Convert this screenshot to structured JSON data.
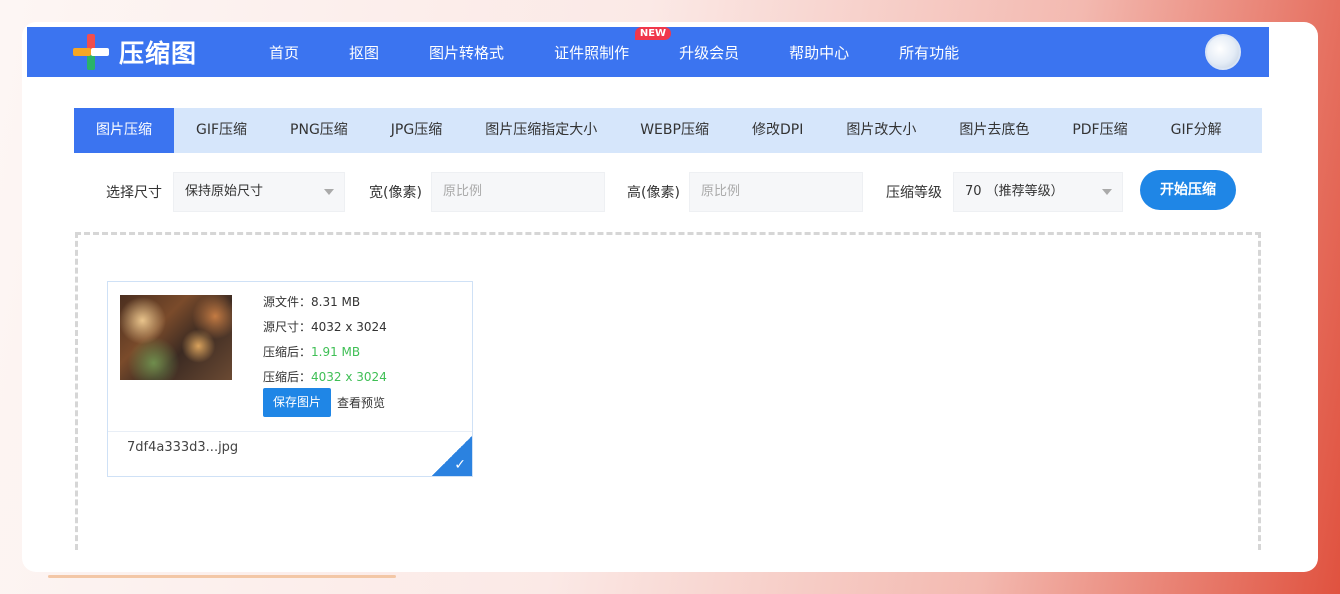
{
  "header": {
    "brand": "压缩图",
    "nav": [
      {
        "label": "首页"
      },
      {
        "label": "抠图"
      },
      {
        "label": "图片转格式"
      },
      {
        "label": "证件照制作",
        "badge": "NEW"
      },
      {
        "label": "升级会员"
      },
      {
        "label": "帮助中心"
      },
      {
        "label": "所有功能"
      }
    ]
  },
  "tabs": [
    "图片压缩",
    "GIF压缩",
    "PNG压缩",
    "JPG压缩",
    "图片压缩指定大小",
    "WEBP压缩",
    "修改DPI",
    "图片改大小",
    "图片去底色",
    "PDF压缩",
    "GIF分解"
  ],
  "options": {
    "size_label": "选择尺寸",
    "size_value": "保持原始尺寸",
    "width_label": "宽(像素)",
    "width_placeholder": "原比例",
    "height_label": "高(像素)",
    "height_placeholder": "原比例",
    "level_label": "压缩等级",
    "level_value": "70 （推荐等级）",
    "start_button": "开始压缩"
  },
  "file": {
    "source_size": "源文件：8.31 MB",
    "source_dims": "源尺寸：4032 x 3024",
    "compressed_size_label": "压缩后：",
    "compressed_size": "1.91 MB",
    "compressed_dims_label": "压缩后：",
    "compressed_dims": "4032 x 3024",
    "save_button": "保存图片",
    "preview_link": "查看预览",
    "filename": "7df4a333d3...jpg"
  },
  "colors": {
    "brand_blue": "#3b74f0",
    "tab_bg": "#d6e6fb",
    "button_blue": "#1f86e6",
    "success_green": "#3fbf55",
    "badge_red": "#f0374b"
  },
  "icons": {
    "logo": "colored-cross-logo",
    "dropdown": "chevron-down-icon",
    "done": "check-icon"
  }
}
